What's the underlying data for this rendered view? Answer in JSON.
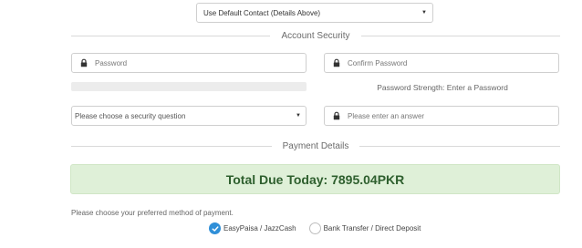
{
  "contact": {
    "selected": "Use Default Contact (Details Above)"
  },
  "account_security": {
    "title": "Account Security",
    "password_placeholder": "Password",
    "confirm_password_placeholder": "Confirm Password",
    "strength_text": "Password Strength: Enter a Password",
    "security_question_selected": "Please choose a security question",
    "answer_placeholder": "Please enter an answer"
  },
  "payment": {
    "title": "Payment Details",
    "total_due": "Total Due Today: 7895.04PKR",
    "prompt": "Please choose your preferred method of payment.",
    "methods": [
      {
        "label": "EasyPaisa / JazzCash",
        "selected": true
      },
      {
        "label": "Bank Transfer / Direct Deposit",
        "selected": false
      }
    ]
  },
  "colors": {
    "total_bg": "#dff0d8",
    "total_text": "#2e5f2e",
    "radio_checked": "#2f8fd8"
  },
  "icons": [
    "lock-icon",
    "chevron-down-icon",
    "check-icon"
  ]
}
